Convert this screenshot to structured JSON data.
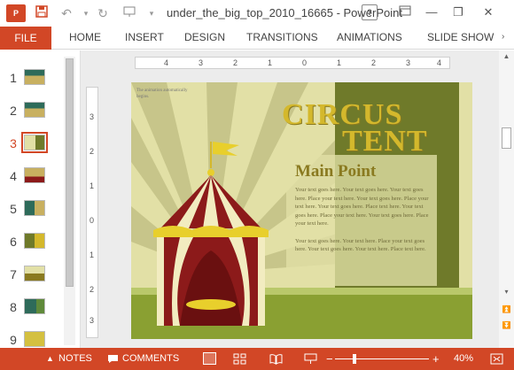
{
  "titlebar": {
    "app_icon_label": "P",
    "title": "under_the_big_top_2010_16665 - PowerPoint",
    "help_label": "?",
    "min_label": "—",
    "restore_label": "❐",
    "close_label": "✕"
  },
  "ribbon": {
    "file_label": "FILE",
    "tabs": [
      "HOME",
      "INSERT",
      "DESIGN",
      "TRANSITIONS",
      "ANIMATIONS",
      "SLIDE SHOW"
    ]
  },
  "thumbnails": {
    "numbers": [
      "1",
      "2",
      "3",
      "4",
      "5",
      "6",
      "7",
      "8",
      "9"
    ],
    "active": 3
  },
  "rulers": {
    "h_ticks": [
      "4",
      "3",
      "2",
      "1",
      "0",
      "1",
      "2",
      "3",
      "4"
    ],
    "v_ticks": [
      "3",
      "2",
      "1",
      "0",
      "1",
      "2",
      "3"
    ]
  },
  "slide": {
    "anim_note": "The animation automatically begins.",
    "title_line1": "CIRCUS",
    "title_line2": "TENT",
    "heading": "Main Point",
    "para1": "Your text goes here. Your text goes here. Your text goes here. Place your text here. Your text goes here. Place your text here. Your text goes here. Place text here. Your text goes here. Place your text here. Your text goes here. Place your text here.",
    "para2": "Your text goes here. Your text here. Place your text goes here. Your text goes here. Your text here. Place text here."
  },
  "statusbar": {
    "notes_label": "NOTES",
    "comments_label": "COMMENTS",
    "zoom_minus": "−",
    "zoom_plus": "+",
    "zoom_level": "40%",
    "zoom_fraction": 0.2
  },
  "colors": {
    "accent": "#d24726",
    "slide_bg": "#e2e0a6",
    "panel_green": "#6f7a2a",
    "grass": "#8aa032",
    "tent_red": "#8c1a1a",
    "tent_cream": "#f2ecc0",
    "title_gold": "#d4b82c"
  }
}
